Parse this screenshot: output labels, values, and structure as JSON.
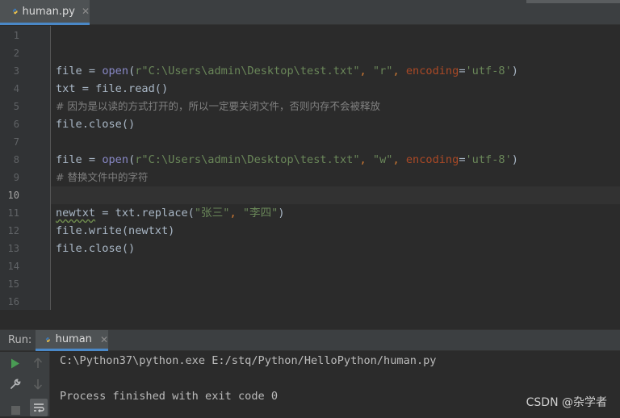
{
  "editor_tab": {
    "label": "human.py",
    "close": "✕"
  },
  "editor": {
    "current_line": 10,
    "lines": [
      {
        "num": "1"
      },
      {
        "num": "2"
      },
      {
        "num": "3"
      },
      {
        "num": "4"
      },
      {
        "num": "5"
      },
      {
        "num": "6"
      },
      {
        "num": "7"
      },
      {
        "num": "8"
      },
      {
        "num": "9"
      },
      {
        "num": "10"
      },
      {
        "num": "11"
      },
      {
        "num": "12"
      },
      {
        "num": "13"
      },
      {
        "num": "14"
      },
      {
        "num": "15"
      },
      {
        "num": "16"
      }
    ],
    "code": {
      "l3": {
        "var": "file",
        "eq": " = ",
        "fn": "open",
        "p1": "(",
        "str1": "r\"C:\\Users\\admin\\Desktop\\test.txt\"",
        "sep1": ", ",
        "str2": "\"r\"",
        "sep2": ", ",
        "param": "encoding",
        "eq2": "=",
        "str3": "'utf-8'",
        "p2": ")"
      },
      "l4": {
        "text": "txt = file.read()"
      },
      "l5": {
        "text": "# 因为是以读的方式打开的，所以一定要关闭文件，否则内存不会被释放"
      },
      "l6": {
        "text": "file.close()"
      },
      "l8": {
        "var": "file",
        "eq": " = ",
        "fn": "open",
        "p1": "(",
        "str1": "r\"C:\\Users\\admin\\Desktop\\test.txt\"",
        "sep1": ", ",
        "str2": "\"w\"",
        "sep2": ", ",
        "param": "encoding",
        "eq2": "=",
        "str3": "'utf-8'",
        "p2": ")"
      },
      "l9": {
        "text": "# 替换文件中的字符"
      },
      "l11": {
        "var": "newtxt",
        "rest": " = txt.replace(",
        "str1": "\"张三\"",
        "sep": ", ",
        "str2": "\"李四\"",
        "p2": ")"
      },
      "l12": {
        "text": "file.write(newtxt)"
      },
      "l13": {
        "text": "file.close()"
      }
    }
  },
  "run_panel": {
    "title": "Run:",
    "tab_label": "human",
    "close": "✕",
    "console": [
      "C:\\Python37\\python.exe E:/stq/Python/HelloPython/human.py",
      "",
      "Process finished with exit code 0"
    ]
  },
  "watermark": "CSDN @杂学者",
  "colors": {
    "accent": "#4a88c7",
    "run_green": "#499c54",
    "string": "#6a8759",
    "keyword": "#cc7832",
    "builtin": "#8888c6",
    "comment": "#808080"
  }
}
